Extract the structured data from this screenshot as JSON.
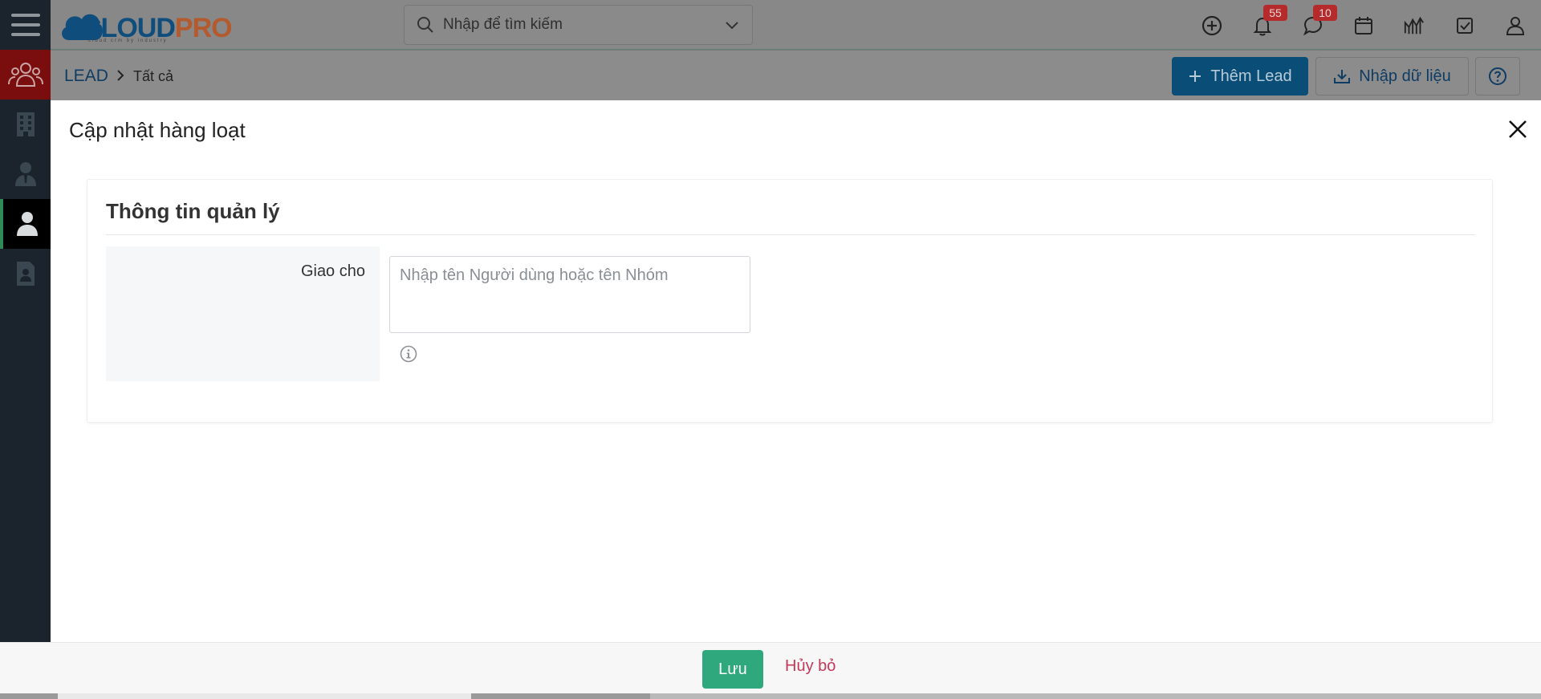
{
  "header": {
    "logo_main": "CLOUD",
    "logo_accent": "PRO",
    "logo_tagline": "cloud crm by industry",
    "search_placeholder": "Nhập để tìm kiếm",
    "notifications_count": "55",
    "messages_count": "10"
  },
  "icons": {
    "menu": "hamburger-icon",
    "search": "search-icon",
    "add": "plus-circle-icon",
    "notifications": "bell-icon",
    "messages": "chat-icon",
    "calendar": "calendar-icon",
    "reports": "chart-icon",
    "tasks": "checkbox-icon",
    "profile": "user-icon"
  },
  "sidebar": {
    "items": [
      {
        "name": "leads",
        "icon": "group-icon"
      },
      {
        "name": "organizations",
        "icon": "building-icon"
      },
      {
        "name": "contacts",
        "icon": "contact-icon"
      },
      {
        "name": "users",
        "icon": "person-icon"
      },
      {
        "name": "documents",
        "icon": "document-icon"
      }
    ]
  },
  "breadcrumb": {
    "module": "LEAD",
    "view": "Tất cả"
  },
  "actions": {
    "add_label": "Thêm Lead",
    "import_label": "Nhập dữ liệu"
  },
  "modal": {
    "title": "Cập nhật hàng loạt",
    "section_title": "Thông tin quản lý",
    "assign_label": "Giao cho",
    "assign_placeholder": "Nhập tên Người dùng hoặc tên Nhóm",
    "assign_value": ""
  },
  "footer": {
    "save_label": "Lưu",
    "cancel_label": "Hủy bỏ"
  },
  "colors": {
    "primary": "#0a4d76",
    "save": "#2fa87e",
    "cancel": "#c2395a",
    "sidebar": "#1b242c",
    "badge": "#b52a2a"
  }
}
